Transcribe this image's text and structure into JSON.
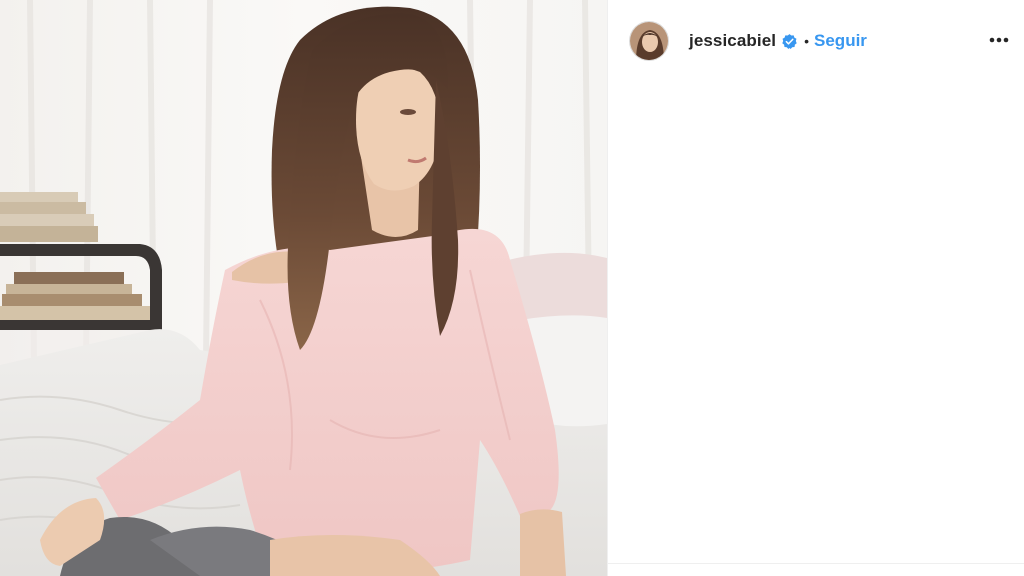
{
  "post": {
    "photo": {
      "subject": "woman with long brown hair in pink long-sleeve top sitting on a bed"
    },
    "header": {
      "username": "jessicabiel",
      "verified_icon": "verified-badge-icon",
      "separator": "•",
      "follow_label": "Seguir",
      "more_icon": "more-options-icon"
    }
  },
  "colors": {
    "follow_blue": "#3897f0",
    "verified_blue": "#3897f0",
    "text": "#262626",
    "divider": "#efefef"
  }
}
